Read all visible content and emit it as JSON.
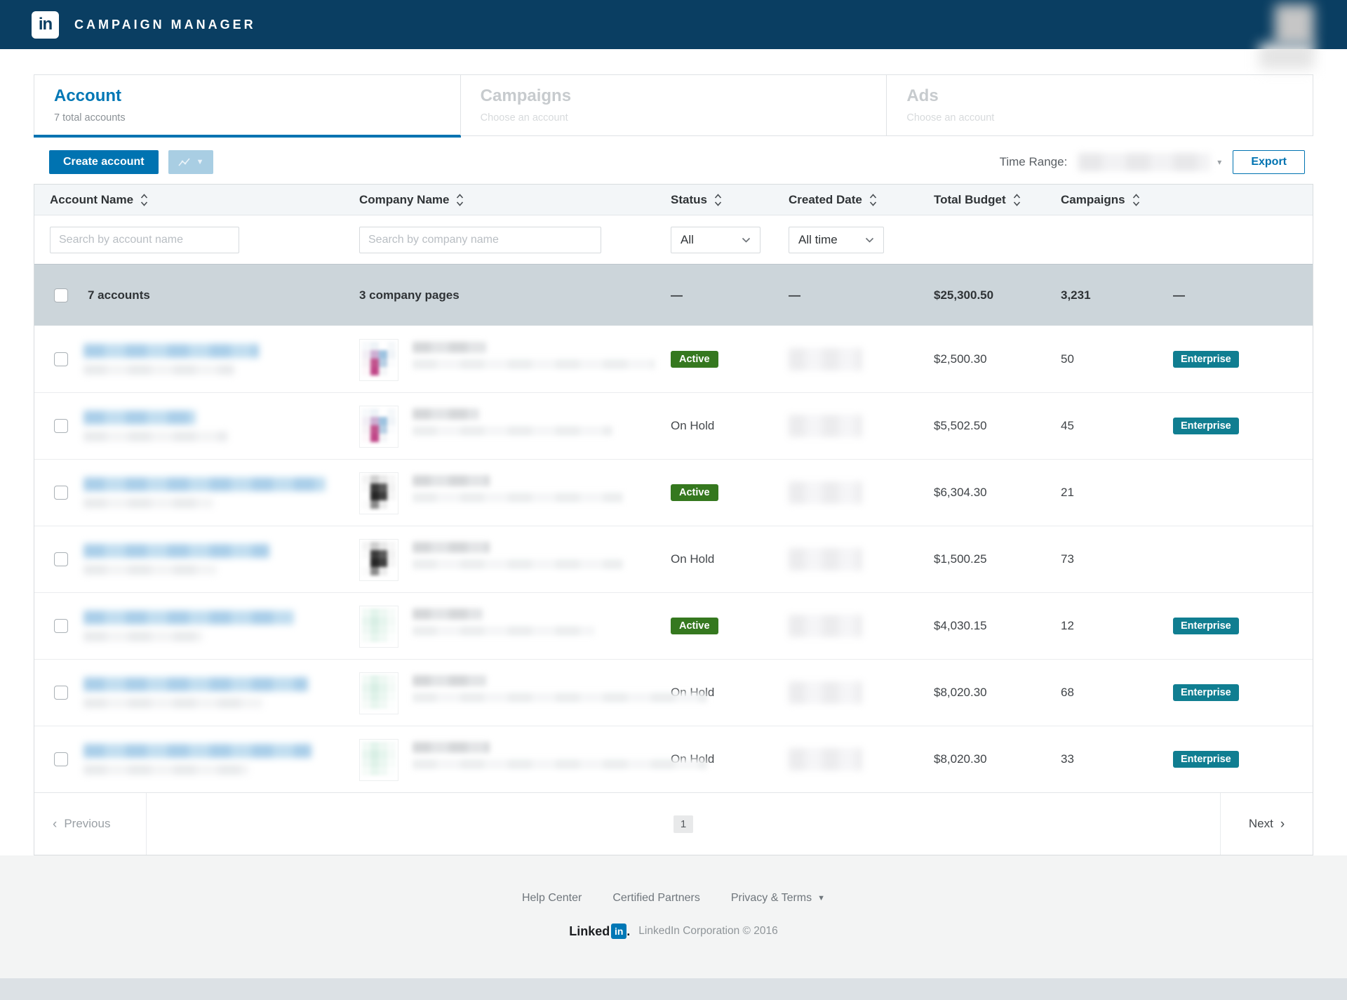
{
  "navbar": {
    "brand": "CAMPAIGN MANAGER",
    "logo": "in"
  },
  "tabs": [
    {
      "title": "Account",
      "subtitle": "7 total accounts",
      "active": true
    },
    {
      "title": "Campaigns",
      "subtitle": "Choose an account",
      "active": false
    },
    {
      "title": "Ads",
      "subtitle": "Choose an account",
      "active": false
    }
  ],
  "toolbar": {
    "create_label": "Create account",
    "time_range_label": "Time Range:",
    "export_label": "Export"
  },
  "table": {
    "columns": [
      "Account Name",
      "Company Name",
      "Status",
      "Created Date",
      "Total Budget",
      "Campaigns"
    ],
    "filters": {
      "account_placeholder": "Search by account name",
      "company_placeholder": "Search by company name",
      "status_value": "All",
      "created_value": "All time"
    },
    "summary": {
      "accounts": "7 accounts",
      "company_pages": "3 company pages",
      "status": "—",
      "created": "—",
      "total_budget": "$25,300.50",
      "campaigns": "3,231",
      "tier": "—"
    },
    "rows": [
      {
        "status": "Active",
        "status_badge": true,
        "budget": "$2,500.30",
        "campaigns": "50",
        "tier": "Enterprise",
        "logo_variant": "pink",
        "name_w": 250,
        "id_w": 215,
        "co1_w": 105,
        "co2_w": 345
      },
      {
        "status": "On Hold",
        "status_badge": false,
        "budget": "$5,502.50",
        "campaigns": "45",
        "tier": "Enterprise",
        "logo_variant": "pink",
        "name_w": 160,
        "id_w": 205,
        "co1_w": 95,
        "co2_w": 285
      },
      {
        "status": "Active",
        "status_badge": true,
        "budget": "$6,304.30",
        "campaigns": "21",
        "tier": "",
        "logo_variant": "dark",
        "name_w": 345,
        "id_w": 185,
        "co1_w": 110,
        "co2_w": 300
      },
      {
        "status": "On Hold",
        "status_badge": false,
        "budget": "$1,500.25",
        "campaigns": "73",
        "tier": "",
        "logo_variant": "dark",
        "name_w": 265,
        "id_w": 190,
        "co1_w": 110,
        "co2_w": 300
      },
      {
        "status": "Active",
        "status_badge": true,
        "budget": "$4,030.15",
        "campaigns": "12",
        "tier": "Enterprise",
        "logo_variant": "mint",
        "name_w": 300,
        "id_w": 170,
        "co1_w": 100,
        "co2_w": 260
      },
      {
        "status": "On Hold",
        "status_badge": false,
        "budget": "$8,020.30",
        "campaigns": "68",
        "tier": "Enterprise",
        "logo_variant": "mint",
        "name_w": 320,
        "id_w": 255,
        "co1_w": 105,
        "co2_w": 420
      },
      {
        "status": "On Hold",
        "status_badge": false,
        "budget": "$8,020.30",
        "campaigns": "33",
        "tier": "Enterprise",
        "logo_variant": "mint",
        "name_w": 325,
        "id_w": 235,
        "co1_w": 110,
        "co2_w": 420
      }
    ]
  },
  "pagination": {
    "previous": "Previous",
    "page": "1",
    "next": "Next"
  },
  "footer": {
    "links": [
      "Help Center",
      "Certified Partners",
      "Privacy & Terms"
    ],
    "logo_word": "Linked",
    "logo_in": "in",
    "logo_dot": ".",
    "copyright": "LinkedIn Corporation © 2016"
  },
  "colors": {
    "navbar": "#0a3e62",
    "accent": "#0073b1",
    "tab_blue": "#0077b5",
    "active_green": "#35781f",
    "enterprise_teal": "#107e91",
    "summary_bg": "#ccd5da"
  }
}
